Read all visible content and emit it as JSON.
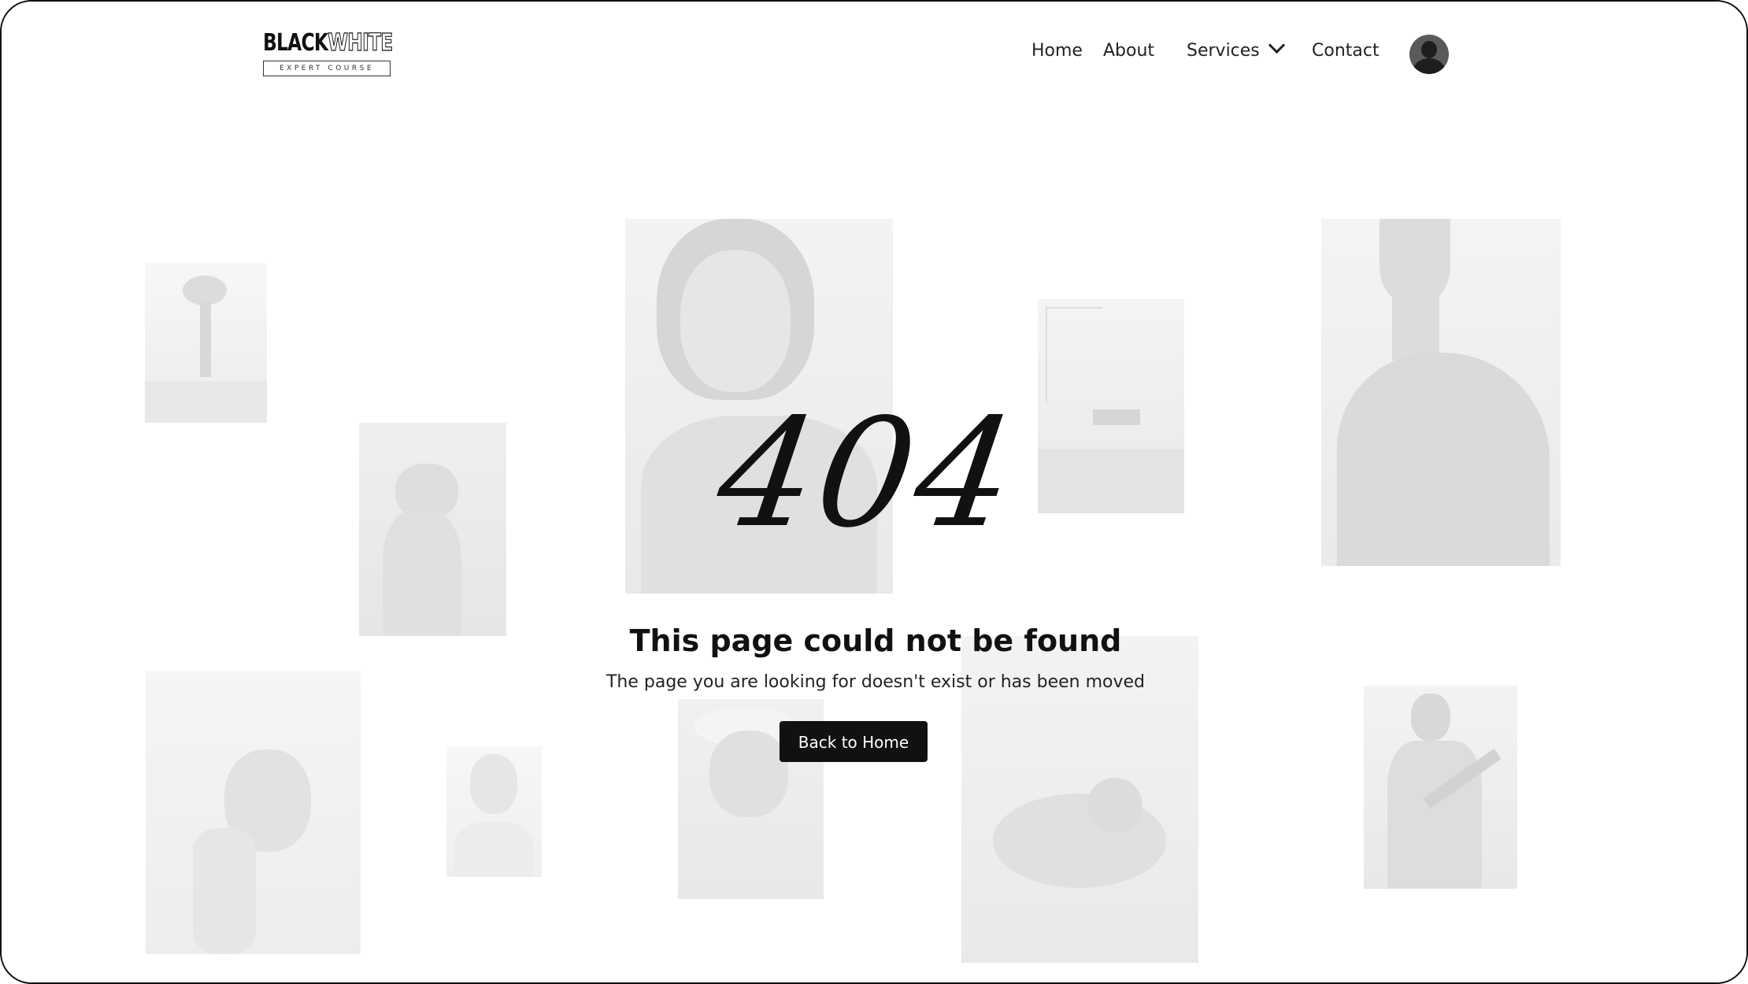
{
  "logo": {
    "brand_black": "BLACK",
    "brand_white": "WHITE",
    "tagline": "EXPERT COURSE"
  },
  "nav": {
    "items": [
      {
        "label": "Home"
      },
      {
        "label": "About"
      },
      {
        "label": "Services"
      },
      {
        "label": "Contact"
      }
    ]
  },
  "error": {
    "code": "404",
    "title": "This page could not be found",
    "message": "The page you are looking for doesn't exist or has been moved",
    "button_label": "Back to Home"
  },
  "colors": {
    "text": "#111111",
    "button_bg": "#111111",
    "button_text": "#ffffff",
    "photo_tint": "#eeeeee"
  }
}
